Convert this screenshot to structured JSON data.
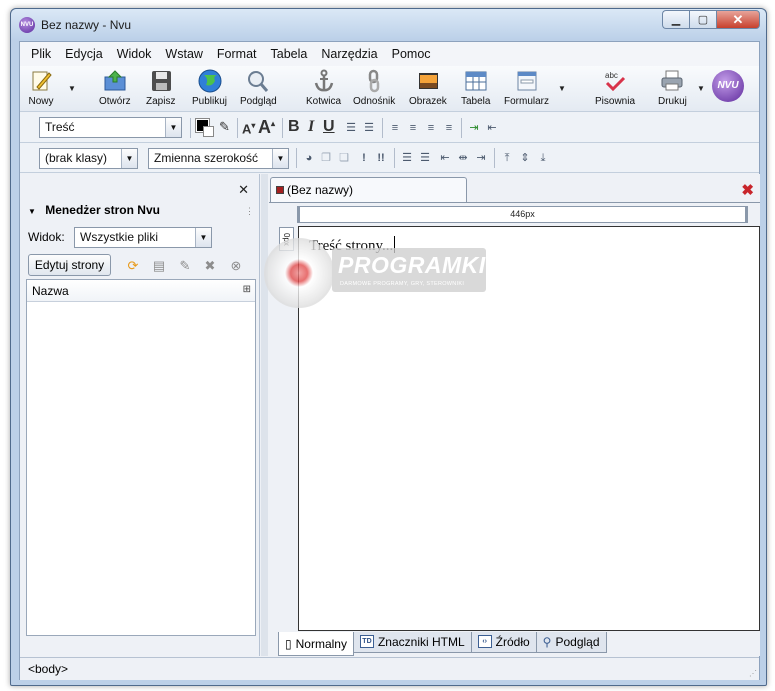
{
  "window": {
    "title": "Bez nazwy - Nvu",
    "app_icon_text": "NVU"
  },
  "menu": [
    "Plik",
    "Edycja",
    "Widok",
    "Wstaw",
    "Format",
    "Tabela",
    "Narzędzia",
    "Pomoc"
  ],
  "toolbar": {
    "new": "Nowy",
    "open": "Otwórz",
    "save": "Zapisz",
    "publish": "Publikuj",
    "preview": "Podgląd",
    "anchor": "Kotwica",
    "link": "Odnośnik",
    "image": "Obrazek",
    "table": "Tabela",
    "form": "Formularz",
    "spell": "Pisownia",
    "print": "Drukuj",
    "nvu_logo": "NVU"
  },
  "format_bar": {
    "paragraph_style": "Treść",
    "class": "(brak klasy)",
    "font": "Zmienna szerokość"
  },
  "site_manager": {
    "title": "Menedżer stron Nvu",
    "view_label": "Widok:",
    "view_value": "Wszystkie pliki",
    "edit_button": "Edytuj strony",
    "column_name": "Nazwa",
    "close_glyph": "✕"
  },
  "editor": {
    "tab_title": "(Bez nazwy)",
    "ruler_label": "446px",
    "vruler_label": "0px",
    "content": "Treść strony..."
  },
  "mode_tabs": [
    "Normalny",
    "Znaczniki HTML",
    "Źródło",
    "Podgląd"
  ],
  "status": {
    "text": "<body>"
  },
  "watermark": {
    "title": "PROGRAMKI.PL",
    "subtitle": "DARMOWE PROGRAMY, GRY, STEROWNIKI"
  }
}
